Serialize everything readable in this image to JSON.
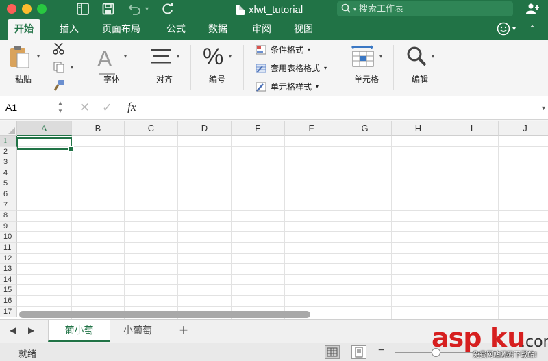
{
  "titlebar": {
    "doc_title": "xlwt_tutorial",
    "search_placeholder": "搜索工作表"
  },
  "tabs": [
    {
      "label": "开始"
    },
    {
      "label": "插入"
    },
    {
      "label": "页面布局"
    },
    {
      "label": "公式"
    },
    {
      "label": "数据"
    },
    {
      "label": "审阅"
    },
    {
      "label": "视图"
    }
  ],
  "ribbon": {
    "paste_label": "粘贴",
    "font_label": "字体",
    "align_label": "对齐",
    "number_label": "编号",
    "conditional_format": "条件格式",
    "table_format": "套用表格格式",
    "cell_style": "单元格样式",
    "cells_label": "单元格",
    "edit_label": "编辑"
  },
  "formula_bar": {
    "name_box": "A1",
    "fx": "fx",
    "formula": ""
  },
  "grid": {
    "columns": [
      "A",
      "B",
      "C",
      "D",
      "E",
      "F",
      "G",
      "H",
      "I",
      "J"
    ],
    "rows": [
      "1",
      "2",
      "3",
      "4",
      "5",
      "6",
      "7",
      "8",
      "9",
      "10",
      "11",
      "12",
      "13",
      "14",
      "15",
      "16",
      "17"
    ],
    "selected_cell": "A1"
  },
  "sheets": [
    {
      "name": "葡小萄",
      "active": true
    },
    {
      "name": "小葡萄",
      "active": false
    }
  ],
  "statusbar": {
    "status": "就绪"
  },
  "watermark": {
    "asp": "asp",
    "ku": "ku",
    "com": ".com",
    "sub": "免费网站源码下载站!"
  },
  "colors": {
    "accent": "#217346"
  }
}
